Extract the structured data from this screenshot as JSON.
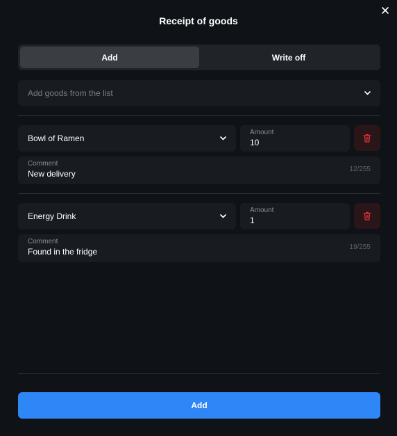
{
  "dialog": {
    "title": "Receipt of goods",
    "close_icon": "close-icon"
  },
  "tabs": [
    {
      "label": "Add",
      "active": true
    },
    {
      "label": "Write off",
      "active": false
    }
  ],
  "goods_select": {
    "placeholder": "Add goods from the list",
    "icon": "chevron-down-icon"
  },
  "items": [
    {
      "product": "Bowl of Ramen",
      "amount_label": "Amount",
      "amount": "10",
      "comment_label": "Comment",
      "comment": "New delivery",
      "counter": "12/255",
      "delete_icon": "trash-icon"
    },
    {
      "product": "Energy Drink",
      "amount_label": "Amount",
      "amount": "1",
      "comment_label": "Comment",
      "comment": "Found in the fridge",
      "counter": "19/255",
      "delete_icon": "trash-icon"
    }
  ],
  "footer": {
    "submit_label": "Add"
  },
  "colors": {
    "background": "#0f1216",
    "field": "#181b20",
    "accent": "#2f86f6",
    "danger": "#e0333d",
    "danger_bg": "#2a1619"
  }
}
